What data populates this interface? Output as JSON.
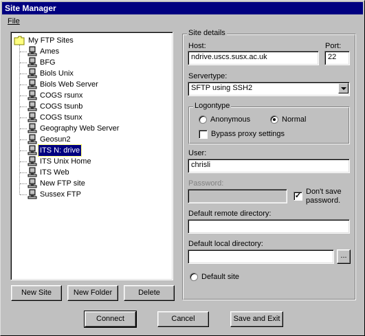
{
  "window": {
    "title": "Site Manager"
  },
  "menu": {
    "file": "File"
  },
  "tree": {
    "root": "My FTP Sites",
    "items": [
      {
        "label": "Ames",
        "selected": false
      },
      {
        "label": "BFG",
        "selected": false
      },
      {
        "label": "Biols Unix",
        "selected": false
      },
      {
        "label": "Biols Web Server",
        "selected": false
      },
      {
        "label": "COGS rsunx",
        "selected": false
      },
      {
        "label": "COGS tsunb",
        "selected": false
      },
      {
        "label": "COGS tsunx",
        "selected": false
      },
      {
        "label": "Geography Web Server",
        "selected": false
      },
      {
        "label": "Geosun2",
        "selected": false
      },
      {
        "label": "ITS N: drive",
        "selected": true
      },
      {
        "label": "ITS Unix Home",
        "selected": false
      },
      {
        "label": "ITS Web",
        "selected": false
      },
      {
        "label": "New FTP site",
        "selected": false
      },
      {
        "label": "Sussex FTP",
        "selected": false
      }
    ]
  },
  "buttons": {
    "new_site": "New Site",
    "new_folder": "New Folder",
    "delete": "Delete",
    "connect": "Connect",
    "cancel": "Cancel",
    "save_exit": "Save and Exit",
    "browse": "..."
  },
  "details": {
    "group_label": "Site details",
    "host_label": "Host:",
    "host_value": "ndrive.uscs.susx.ac.uk",
    "port_label": "Port:",
    "port_value": "22",
    "servertype_label": "Servertype:",
    "servertype_value": "SFTP using SSH2",
    "logontype_label": "Logontype",
    "anonymous": "Anonymous",
    "normal": "Normal",
    "logontype_selected": "Normal",
    "bypass_proxy": "Bypass proxy settings",
    "bypass_proxy_checked": false,
    "user_label": "User:",
    "user_value": "chrisli",
    "password_label": "Password:",
    "password_value": "",
    "dont_save_1": "Don't save",
    "dont_save_2": "password.",
    "dont_save_checked": true,
    "remote_dir_label": "Default remote directory:",
    "remote_dir_value": "",
    "local_dir_label": "Default local directory:",
    "local_dir_value": "",
    "default_site": "Default site",
    "default_site_selected": false
  }
}
